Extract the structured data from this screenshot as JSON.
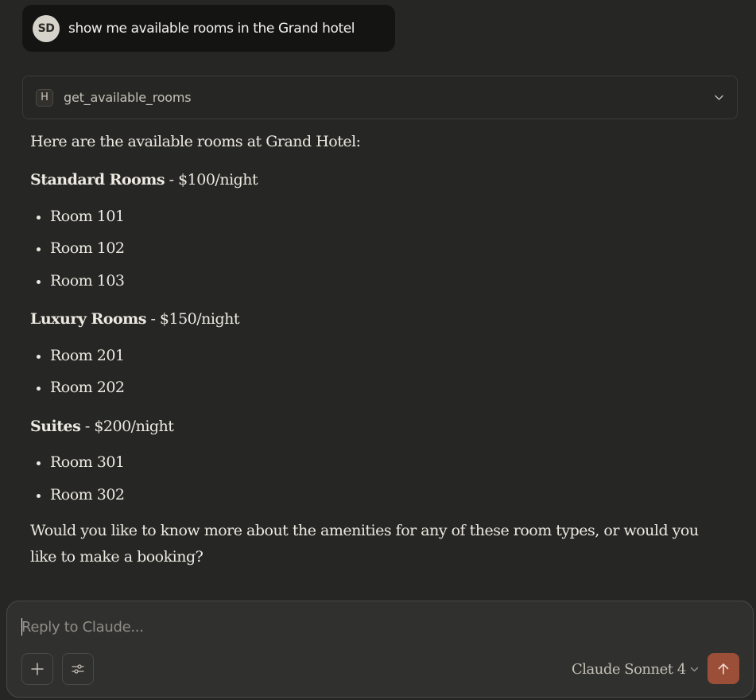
{
  "user_message": {
    "avatar_initials": "SD",
    "text": "show me available rooms in the Grand hotel"
  },
  "tool_call": {
    "badge": "H",
    "name": "get_available_rooms",
    "icon": "chevron-down-icon"
  },
  "response": {
    "intro": "Here are the available rooms at Grand Hotel:",
    "sections": [
      {
        "title": "Standard Rooms",
        "price": " - $100/night",
        "rooms": [
          "Room 101",
          "Room 102",
          "Room 103"
        ]
      },
      {
        "title": "Luxury Rooms",
        "price": " - $150/night",
        "rooms": [
          "Room 201",
          "Room 202"
        ]
      },
      {
        "title": "Suites",
        "price": " - $200/night",
        "rooms": [
          "Room 301",
          "Room 302"
        ]
      }
    ],
    "closing_line1": "Would you like to know more about the amenities for any of these room types, or would you",
    "closing_line2": "like to make a booking?"
  },
  "composer": {
    "placeholder": "Reply to Claude...",
    "value": "",
    "add_icon": "plus-icon",
    "tools_icon": "sliders-icon",
    "model_label": "Claude Sonnet 4",
    "send_icon": "arrow-up-icon"
  },
  "colors": {
    "background": "#262624",
    "send_button": "#9b4f38",
    "user_bubble": "#141413"
  }
}
